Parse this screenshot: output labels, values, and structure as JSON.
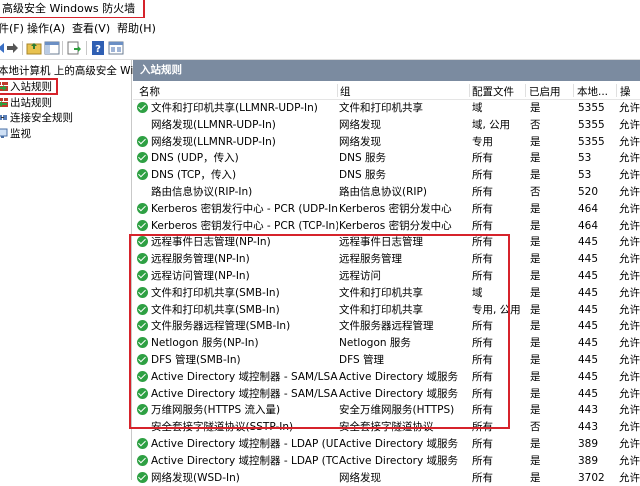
{
  "window": {
    "title": "高级安全 Windows 防火墙"
  },
  "menu": [
    "件(F)",
    "操作(A)",
    "查看(V)",
    "帮助(H)"
  ],
  "toolbar": {
    "icons": [
      "back-icon",
      "forward-icon",
      "up-folder-icon",
      "show-hide-tree-icon",
      "export-icon",
      "help-icon",
      "properties-icon"
    ]
  },
  "tree": {
    "root": "本地计算机 上的高级安全 Windo",
    "items": [
      "入站规则",
      "出站规则",
      "连接安全规则",
      "监视"
    ]
  },
  "panel": {
    "title": "入站规则"
  },
  "table": {
    "columns": [
      "名称",
      "组",
      "配置文件",
      "已启用",
      "本地...",
      "操"
    ],
    "rows": [
      {
        "on": true,
        "name": "文件和打印机共享(LLMNR-UDP-In)",
        "group": "文件和打印机共享",
        "profile": "域",
        "enabled": "是",
        "port": "5355",
        "action": "允许"
      },
      {
        "on": false,
        "name": "网络发现(LLMNR-UDP-In)",
        "group": "网络发现",
        "profile": "域, 公用",
        "enabled": "否",
        "port": "5355",
        "action": "允许"
      },
      {
        "on": true,
        "name": "网络发现(LLMNR-UDP-In)",
        "group": "网络发现",
        "profile": "专用",
        "enabled": "是",
        "port": "5355",
        "action": "允许"
      },
      {
        "on": true,
        "name": "DNS (UDP，传入)",
        "group": "DNS 服务",
        "profile": "所有",
        "enabled": "是",
        "port": "53",
        "action": "允许"
      },
      {
        "on": true,
        "name": "DNS (TCP，传入)",
        "group": "DNS 服务",
        "profile": "所有",
        "enabled": "是",
        "port": "53",
        "action": "允许"
      },
      {
        "on": false,
        "name": "路由信息协议(RIP-In)",
        "group": "路由信息协议(RIP)",
        "profile": "所有",
        "enabled": "否",
        "port": "520",
        "action": "允许"
      },
      {
        "on": true,
        "name": "Kerberos 密钥发行中心 - PCR (UDP-In)",
        "group": "Kerberos 密钥分发中心",
        "profile": "所有",
        "enabled": "是",
        "port": "464",
        "action": "允许"
      },
      {
        "on": true,
        "name": "Kerberos 密钥发行中心 - PCR (TCP-In)",
        "group": "Kerberos 密钥分发中心",
        "profile": "所有",
        "enabled": "是",
        "port": "464",
        "action": "允许"
      },
      {
        "on": true,
        "name": "远程事件日志管理(NP-In)",
        "group": "远程事件日志管理",
        "profile": "所有",
        "enabled": "是",
        "port": "445",
        "action": "允许"
      },
      {
        "on": true,
        "name": "远程服务管理(NP-In)",
        "group": "远程服务管理",
        "profile": "所有",
        "enabled": "是",
        "port": "445",
        "action": "允许"
      },
      {
        "on": true,
        "name": "远程访问管理(NP-In)",
        "group": "远程访问",
        "profile": "所有",
        "enabled": "是",
        "port": "445",
        "action": "允许"
      },
      {
        "on": true,
        "name": "文件和打印机共享(SMB-In)",
        "group": "文件和打印机共享",
        "profile": "域",
        "enabled": "是",
        "port": "445",
        "action": "允许"
      },
      {
        "on": true,
        "name": "文件和打印机共享(SMB-In)",
        "group": "文件和打印机共享",
        "profile": "专用, 公用",
        "enabled": "是",
        "port": "445",
        "action": "允许"
      },
      {
        "on": true,
        "name": "文件服务器远程管理(SMB-In)",
        "group": "文件服务器远程管理",
        "profile": "所有",
        "enabled": "是",
        "port": "445",
        "action": "允许"
      },
      {
        "on": true,
        "name": "Netlogon 服务(NP-In)",
        "group": "Netlogon 服务",
        "profile": "所有",
        "enabled": "是",
        "port": "445",
        "action": "允许"
      },
      {
        "on": true,
        "name": "DFS 管理(SMB-In)",
        "group": "DFS 管理",
        "profile": "所有",
        "enabled": "是",
        "port": "445",
        "action": "允许"
      },
      {
        "on": true,
        "name": "Active Directory 域控制器 - SAM/LSA (...",
        "group": "Active Directory 域服务",
        "profile": "所有",
        "enabled": "是",
        "port": "445",
        "action": "允许"
      },
      {
        "on": true,
        "name": "Active Directory 域控制器 - SAM/LSA (...",
        "group": "Active Directory 域服务",
        "profile": "所有",
        "enabled": "是",
        "port": "445",
        "action": "允许"
      },
      {
        "on": true,
        "name": "万维网服务(HTTPS 流入量)",
        "group": "安全万维网服务(HTTPS)",
        "profile": "所有",
        "enabled": "是",
        "port": "443",
        "action": "允许"
      },
      {
        "on": false,
        "name": "安全套接字隧道协议(SSTP-In)",
        "group": "安全套接字隧道协议",
        "profile": "所有",
        "enabled": "否",
        "port": "443",
        "action": "允许"
      },
      {
        "on": true,
        "name": "Active Directory 域控制器 - LDAP (UD...",
        "group": "Active Directory 域服务",
        "profile": "所有",
        "enabled": "是",
        "port": "389",
        "action": "允许"
      },
      {
        "on": true,
        "name": "Active Directory 域控制器 - LDAP (TCP...",
        "group": "Active Directory 域服务",
        "profile": "所有",
        "enabled": "是",
        "port": "389",
        "action": "允许"
      },
      {
        "on": true,
        "name": "网络发现(WSD-In)",
        "group": "网络发现",
        "profile": "所有",
        "enabled": "是",
        "port": "3702",
        "action": "允许"
      }
    ]
  },
  "colors": {
    "header": "#7b8ba0",
    "highlight": "#d6232b",
    "check": "#2ea043"
  }
}
